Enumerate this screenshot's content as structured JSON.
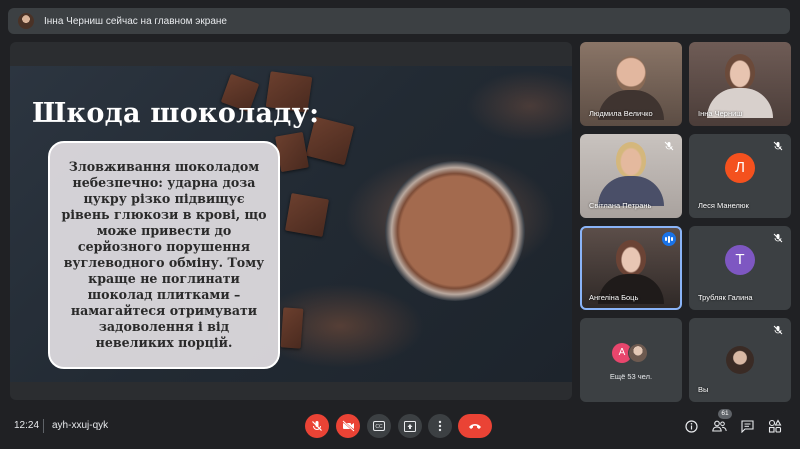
{
  "banner": {
    "text": "Інна Черниш сейчас на главном экране"
  },
  "slide": {
    "title": "Шкода шоколаду:",
    "body": "Зловживання шоколадом небезпечно: ударна доза цукру різко підвищує рівень глюкози в крові, що може привести до серйозного порушення вуглеводного обміну. Тому краще не поглинати шоколад плитками – намагайтеся отримувати задоволення і від невеликих порцій."
  },
  "participants": [
    {
      "name": "Людмила Величко",
      "type": "video",
      "muted": false
    },
    {
      "name": "Інна Черниш",
      "type": "video",
      "muted": false
    },
    {
      "name": "Світлана Петрань",
      "type": "video",
      "muted": true
    },
    {
      "name": "Леся Манелюк",
      "type": "avatar",
      "letter": "Л",
      "color": "#f4511e",
      "muted": true
    },
    {
      "name": "Ангеліна Боць",
      "type": "video",
      "muted": false,
      "speaking": true
    },
    {
      "name": "Трубляк Галина",
      "type": "avatar",
      "letter": "Т",
      "color": "#7e57c2",
      "muted": true
    },
    {
      "more": "Ещё 53 чел.",
      "avatar_letter": "А",
      "avatar_color": "#e8466d"
    },
    {
      "name": "Вы",
      "type": "video",
      "muted": true
    }
  ],
  "bottom": {
    "time": "12:24",
    "meeting_code": "ayh-xxuj-qyk",
    "participants_count": "61",
    "accent_red": "#ea4335",
    "accent_blue": "#1a73e8"
  }
}
